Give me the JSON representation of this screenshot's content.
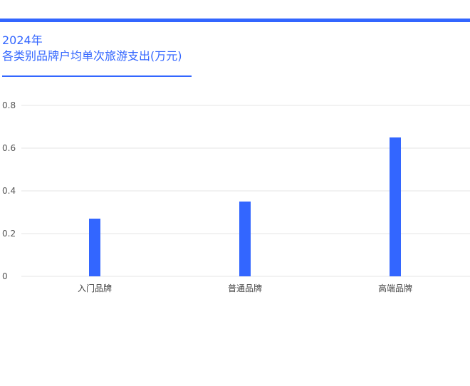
{
  "header": {
    "year": "2024年",
    "title": "各类别品牌户均单次旅游支出(万元)",
    "accent_color": "#3366ff"
  },
  "chart_data": {
    "type": "bar",
    "title": "各类别品牌户均单次旅游支出(万元)",
    "categories": [
      "入门品牌",
      "普通品牌",
      "高端品牌"
    ],
    "values": [
      0.27,
      0.35,
      0.65
    ],
    "yticks": [
      "0",
      "0.2",
      "0.4",
      "0.6",
      "0.8"
    ],
    "ylim": [
      0,
      0.8
    ],
    "xlabel": "",
    "ylabel": "",
    "grid": true,
    "bar_color": "#3366ff",
    "grid_color": "#e6e6e6"
  }
}
